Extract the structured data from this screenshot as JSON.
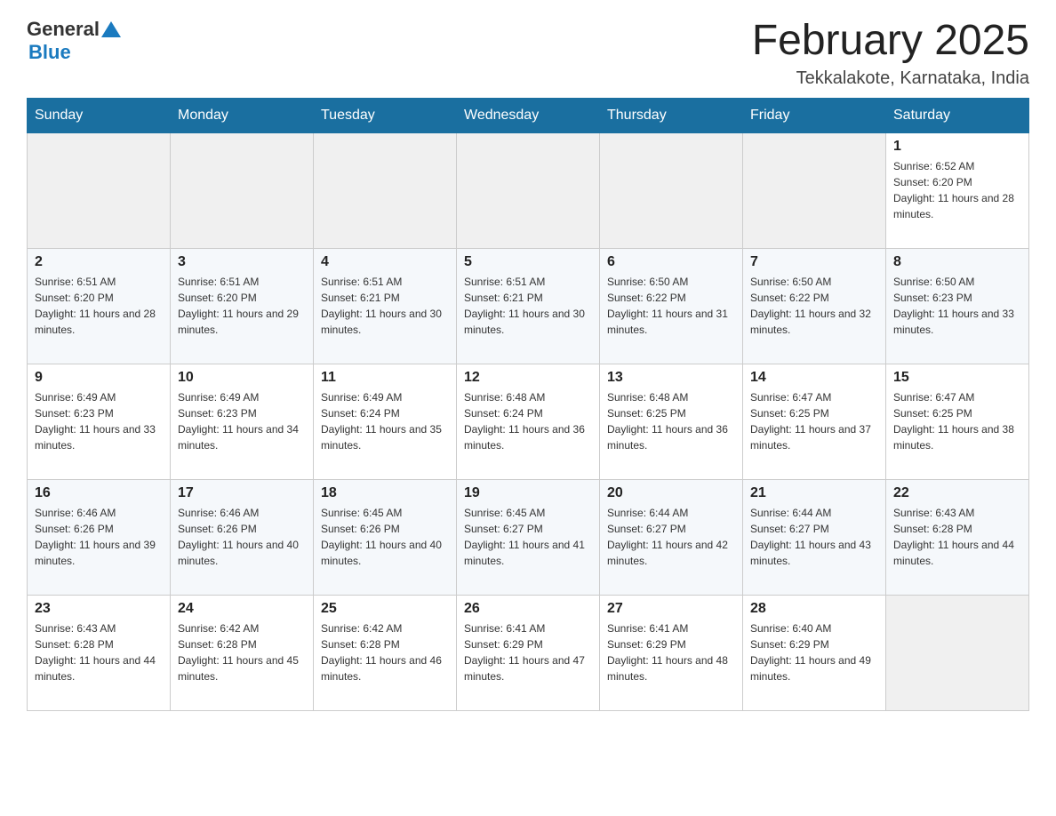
{
  "header": {
    "logo_general": "General",
    "logo_blue": "Blue",
    "month_title": "February 2025",
    "location": "Tekkalakote, Karnataka, India"
  },
  "days_of_week": [
    "Sunday",
    "Monday",
    "Tuesday",
    "Wednesday",
    "Thursday",
    "Friday",
    "Saturday"
  ],
  "weeks": [
    [
      {
        "day": "",
        "info": ""
      },
      {
        "day": "",
        "info": ""
      },
      {
        "day": "",
        "info": ""
      },
      {
        "day": "",
        "info": ""
      },
      {
        "day": "",
        "info": ""
      },
      {
        "day": "",
        "info": ""
      },
      {
        "day": "1",
        "info": "Sunrise: 6:52 AM\nSunset: 6:20 PM\nDaylight: 11 hours and 28 minutes."
      }
    ],
    [
      {
        "day": "2",
        "info": "Sunrise: 6:51 AM\nSunset: 6:20 PM\nDaylight: 11 hours and 28 minutes."
      },
      {
        "day": "3",
        "info": "Sunrise: 6:51 AM\nSunset: 6:20 PM\nDaylight: 11 hours and 29 minutes."
      },
      {
        "day": "4",
        "info": "Sunrise: 6:51 AM\nSunset: 6:21 PM\nDaylight: 11 hours and 30 minutes."
      },
      {
        "day": "5",
        "info": "Sunrise: 6:51 AM\nSunset: 6:21 PM\nDaylight: 11 hours and 30 minutes."
      },
      {
        "day": "6",
        "info": "Sunrise: 6:50 AM\nSunset: 6:22 PM\nDaylight: 11 hours and 31 minutes."
      },
      {
        "day": "7",
        "info": "Sunrise: 6:50 AM\nSunset: 6:22 PM\nDaylight: 11 hours and 32 minutes."
      },
      {
        "day": "8",
        "info": "Sunrise: 6:50 AM\nSunset: 6:23 PM\nDaylight: 11 hours and 33 minutes."
      }
    ],
    [
      {
        "day": "9",
        "info": "Sunrise: 6:49 AM\nSunset: 6:23 PM\nDaylight: 11 hours and 33 minutes."
      },
      {
        "day": "10",
        "info": "Sunrise: 6:49 AM\nSunset: 6:23 PM\nDaylight: 11 hours and 34 minutes."
      },
      {
        "day": "11",
        "info": "Sunrise: 6:49 AM\nSunset: 6:24 PM\nDaylight: 11 hours and 35 minutes."
      },
      {
        "day": "12",
        "info": "Sunrise: 6:48 AM\nSunset: 6:24 PM\nDaylight: 11 hours and 36 minutes."
      },
      {
        "day": "13",
        "info": "Sunrise: 6:48 AM\nSunset: 6:25 PM\nDaylight: 11 hours and 36 minutes."
      },
      {
        "day": "14",
        "info": "Sunrise: 6:47 AM\nSunset: 6:25 PM\nDaylight: 11 hours and 37 minutes."
      },
      {
        "day": "15",
        "info": "Sunrise: 6:47 AM\nSunset: 6:25 PM\nDaylight: 11 hours and 38 minutes."
      }
    ],
    [
      {
        "day": "16",
        "info": "Sunrise: 6:46 AM\nSunset: 6:26 PM\nDaylight: 11 hours and 39 minutes."
      },
      {
        "day": "17",
        "info": "Sunrise: 6:46 AM\nSunset: 6:26 PM\nDaylight: 11 hours and 40 minutes."
      },
      {
        "day": "18",
        "info": "Sunrise: 6:45 AM\nSunset: 6:26 PM\nDaylight: 11 hours and 40 minutes."
      },
      {
        "day": "19",
        "info": "Sunrise: 6:45 AM\nSunset: 6:27 PM\nDaylight: 11 hours and 41 minutes."
      },
      {
        "day": "20",
        "info": "Sunrise: 6:44 AM\nSunset: 6:27 PM\nDaylight: 11 hours and 42 minutes."
      },
      {
        "day": "21",
        "info": "Sunrise: 6:44 AM\nSunset: 6:27 PM\nDaylight: 11 hours and 43 minutes."
      },
      {
        "day": "22",
        "info": "Sunrise: 6:43 AM\nSunset: 6:28 PM\nDaylight: 11 hours and 44 minutes."
      }
    ],
    [
      {
        "day": "23",
        "info": "Sunrise: 6:43 AM\nSunset: 6:28 PM\nDaylight: 11 hours and 44 minutes."
      },
      {
        "day": "24",
        "info": "Sunrise: 6:42 AM\nSunset: 6:28 PM\nDaylight: 11 hours and 45 minutes."
      },
      {
        "day": "25",
        "info": "Sunrise: 6:42 AM\nSunset: 6:28 PM\nDaylight: 11 hours and 46 minutes."
      },
      {
        "day": "26",
        "info": "Sunrise: 6:41 AM\nSunset: 6:29 PM\nDaylight: 11 hours and 47 minutes."
      },
      {
        "day": "27",
        "info": "Sunrise: 6:41 AM\nSunset: 6:29 PM\nDaylight: 11 hours and 48 minutes."
      },
      {
        "day": "28",
        "info": "Sunrise: 6:40 AM\nSunset: 6:29 PM\nDaylight: 11 hours and 49 minutes."
      },
      {
        "day": "",
        "info": ""
      }
    ]
  ]
}
